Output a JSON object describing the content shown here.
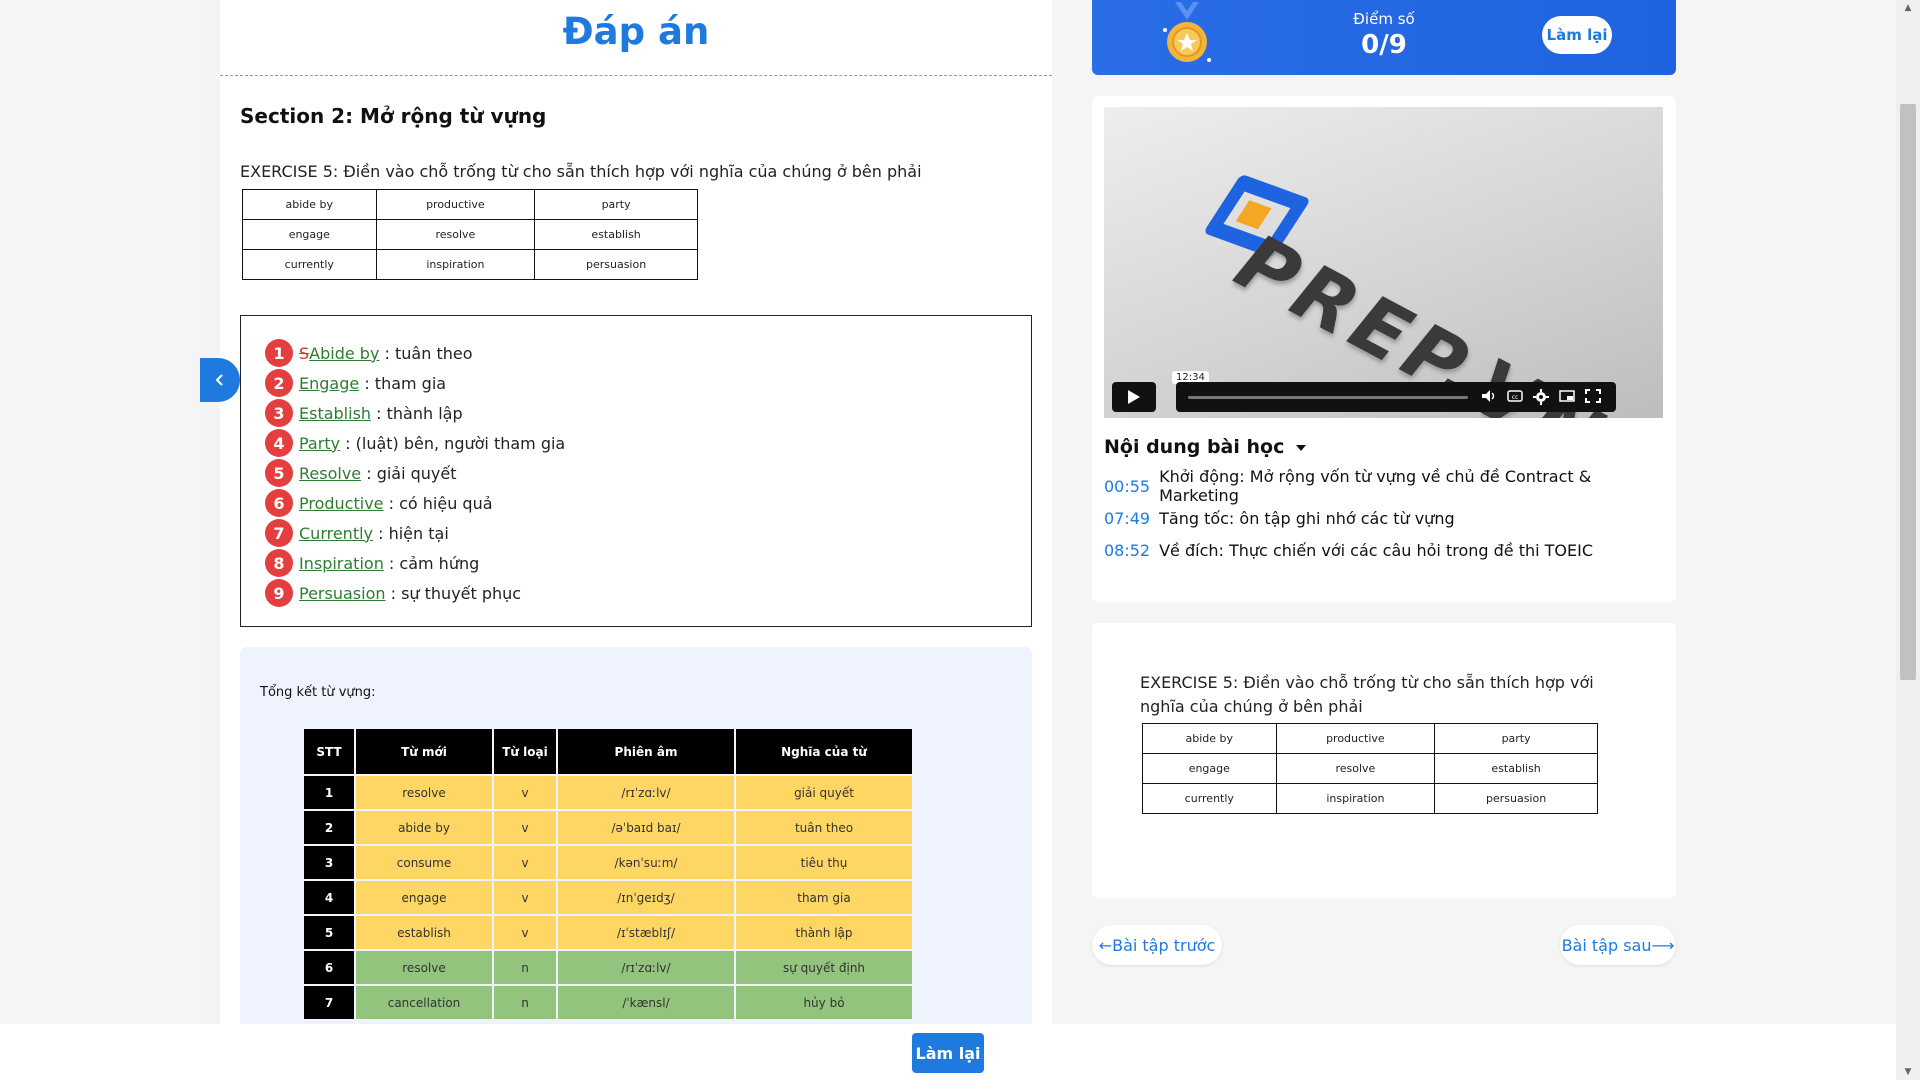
{
  "main": {
    "title": "Đáp án",
    "section_title": "Section 2: Mở rộng từ vựng",
    "exercise_text": "EXERCISE 5: Điền vào chỗ trống từ cho sẵn thích hợp với nghĩa của chúng ở bên phải",
    "word_bank": [
      [
        "abide by",
        "productive",
        "party"
      ],
      [
        "engage",
        "resolve",
        "establish"
      ],
      [
        "currently",
        "inspiration",
        "persuasion"
      ]
    ],
    "answers": [
      {
        "num": "1",
        "prefix": "S",
        "word": "Abide by",
        "meaning": ": tuân theo"
      },
      {
        "num": "2",
        "prefix": "",
        "word": "Engage",
        "meaning": ": tham gia"
      },
      {
        "num": "3",
        "prefix": "",
        "word": "Establish",
        "meaning": ": thành lập"
      },
      {
        "num": "4",
        "prefix": "",
        "word": "Party",
        "meaning": ": (luật) bên, người tham gia"
      },
      {
        "num": "5",
        "prefix": "",
        "word": "Resolve",
        "meaning": ": giải quyết"
      },
      {
        "num": "6",
        "prefix": "",
        "word": "Productive",
        "meaning": ": có hiệu quả"
      },
      {
        "num": "7",
        "prefix": "",
        "word": "Currently",
        "meaning": ": hiện tại"
      },
      {
        "num": "8",
        "prefix": "",
        "word": "Inspiration",
        "meaning": ": cảm hứng"
      },
      {
        "num": "9",
        "prefix": "",
        "word": "Persuasion",
        "meaning": ": sự thuyết phục"
      }
    ],
    "summary_label": "Tổng kết từ vựng:",
    "vocab_headers": [
      "STT",
      "Từ mới",
      "Từ loại",
      "Phiên âm",
      "Nghĩa của từ"
    ],
    "vocab_rows": [
      [
        "1",
        "resolve",
        "v",
        "/rɪˈzɑːlv/",
        "giải quyết"
      ],
      [
        "2",
        "abide by",
        "v",
        "/əˈbaɪd baɪ/",
        "tuân theo"
      ],
      [
        "3",
        "consume",
        "v",
        "/kənˈsuːm/",
        "tiêu thụ"
      ],
      [
        "4",
        "engage",
        "v",
        "/ɪnˈɡeɪdʒ/",
        "tham gia"
      ],
      [
        "5",
        "establish",
        "v",
        "/ɪˈstæblɪʃ/",
        "thành lập"
      ],
      [
        "6",
        "resolve",
        "n",
        "/rɪˈzɑːlv/",
        "sự quyết định"
      ],
      [
        "7",
        "cancellation",
        "n",
        "/ˈkænsl/",
        "hủy bỏ"
      ]
    ]
  },
  "score": {
    "label": "Điểm số",
    "value": "0/9",
    "retry_label": "Làm lại"
  },
  "video": {
    "logo_text": "PREP.VN",
    "time_tooltip": "12:34",
    "icons": [
      "play-icon",
      "volume-icon",
      "cc-icon",
      "settings-icon",
      "miniplayer-icon",
      "fullscreen-icon"
    ]
  },
  "lesson_content": {
    "title": "Nội dung bài học",
    "items": [
      {
        "time": "00:55",
        "text": "Khởi động: Mở rộng vốn từ vựng về chủ đề Contract & Marketing"
      },
      {
        "time": "07:49",
        "text": "Tăng tốc: ôn tập ghi nhớ các từ vựng"
      },
      {
        "time": "08:52",
        "text": "Về đích: Thực chiến với các câu hỏi trong đề thi TOEIC"
      }
    ]
  },
  "exercise_card": {
    "text": "EXERCISE 5: Điền vào chỗ trống từ cho sẵn thích hợp với nghĩa của chúng ở bên phải"
  },
  "nav": {
    "prev_label": "←Bài tập trước",
    "next_label": "Bài tập sau⟶"
  },
  "bottom": {
    "retry_label": "Làm lại"
  },
  "colors": {
    "accent": "#1f7ae0",
    "badge_red": "#e53e3e",
    "answer_green": "#2e7d32",
    "vocab_yellow": "#fdd663",
    "vocab_green": "#93c47d"
  }
}
